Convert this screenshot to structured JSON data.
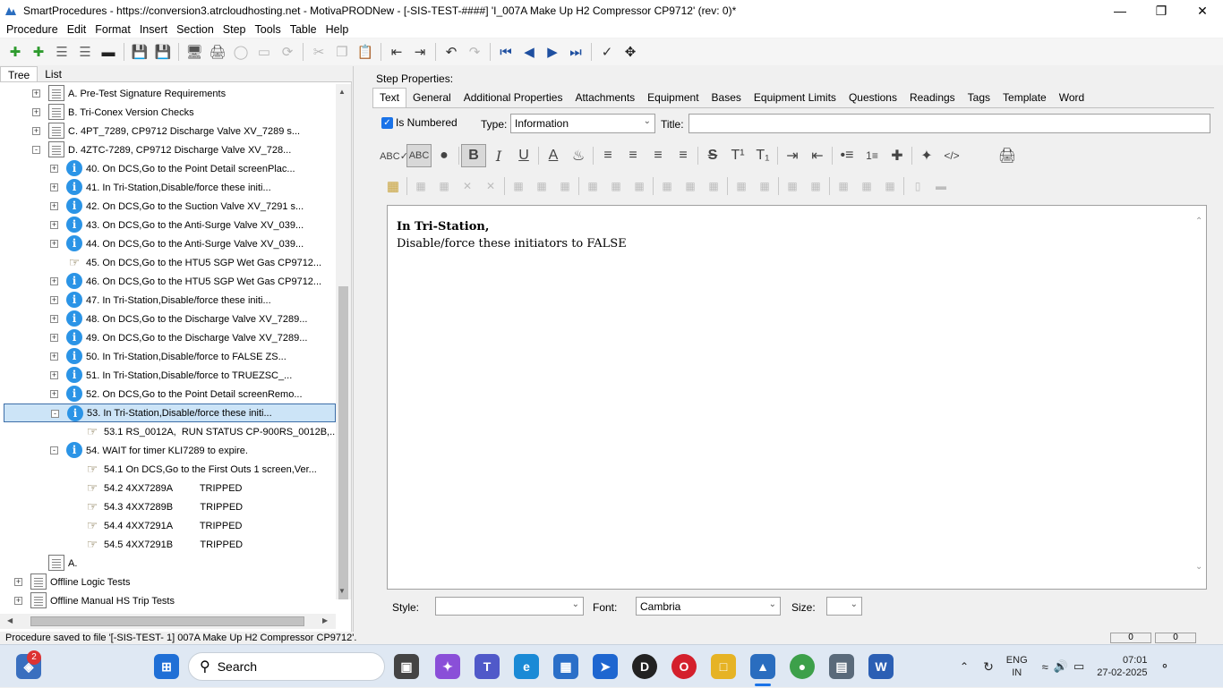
{
  "window": {
    "title": "SmartProcedures - https://conversion3.atrcloudhosting.net - MotivaPRODNew - [-SIS-TEST-####] 'I_007A Make Up H2 Compressor CP9712' (rev: 0)*"
  },
  "menu": [
    "Procedure",
    "Edit",
    "Format",
    "Insert",
    "Section",
    "Step",
    "Tools",
    "Table",
    "Help"
  ],
  "left_tabs": [
    "Tree",
    "List"
  ],
  "tree": [
    {
      "label": "A. Pre-Test Signature Requirements",
      "icon": "doc",
      "level": 1,
      "expander": "+"
    },
    {
      "label": "B. Tri-Conex Version Checks",
      "icon": "doc",
      "level": 1,
      "expander": "+"
    },
    {
      "label": "C. 4PT_7289, CP9712 Discharge Valve XV_7289 s...",
      "icon": "doc",
      "level": 1,
      "expander": "+"
    },
    {
      "label": "D. 4ZTC-7289, CP9712 Discharge Valve XV_728...",
      "icon": "doc",
      "level": 1,
      "expander": "-"
    },
    {
      "label": "40. On DCS,Go to the Point Detail screenPlac...",
      "icon": "info",
      "level": 2,
      "expander": "+"
    },
    {
      "label": "41. In Tri-Station,Disable/force these initi...",
      "icon": "info",
      "level": 2,
      "expander": "+"
    },
    {
      "label": "42. On DCS,Go to the Suction Valve XV_7291 s...",
      "icon": "info",
      "level": 2,
      "expander": "+"
    },
    {
      "label": "43. On DCS,Go to the Anti-Surge Valve XV_039...",
      "icon": "info",
      "level": 2,
      "expander": "+"
    },
    {
      "label": "44. On DCS,Go to the Anti-Surge Valve XV_039...",
      "icon": "info",
      "level": 2,
      "expander": "+"
    },
    {
      "label": "45. On DCS,Go to the HTU5 SGP Wet Gas CP9712...",
      "icon": "hand",
      "level": 2,
      "expander": ""
    },
    {
      "label": "46. On DCS,Go to the HTU5 SGP Wet Gas CP9712...",
      "icon": "info",
      "level": 2,
      "expander": "+"
    },
    {
      "label": "47. In Tri-Station,Disable/force these initi...",
      "icon": "info",
      "level": 2,
      "expander": "+"
    },
    {
      "label": "48. On DCS,Go to the Discharge Valve XV_7289...",
      "icon": "info",
      "level": 2,
      "expander": "+"
    },
    {
      "label": "49. On DCS,Go to the Discharge Valve XV_7289...",
      "icon": "info",
      "level": 2,
      "expander": "+"
    },
    {
      "label": "50. In Tri-Station,Disable/force to FALSE ZS...",
      "icon": "info",
      "level": 2,
      "expander": "+"
    },
    {
      "label": "51. In Tri-Station,Disable/force to TRUEZSC_...",
      "icon": "info",
      "level": 2,
      "expander": "+"
    },
    {
      "label": "52. On DCS,Go to the Point Detail screenRemo...",
      "icon": "info",
      "level": 2,
      "expander": "+"
    },
    {
      "label": "53. In Tri-Station,Disable/force these initi...",
      "icon": "info",
      "level": 2,
      "expander": "-",
      "selected": true
    },
    {
      "label": "53.1 RS_0012A,  RUN STATUS CP-900RS_0012B,...",
      "icon": "hand",
      "level": 3,
      "expander": ""
    },
    {
      "label": "54. WAIT for timer KLI7289 to expire.",
      "icon": "info",
      "level": 2,
      "expander": "-"
    },
    {
      "label": "54.1 On DCS,Go to the First Outs 1 screen,Ver...",
      "icon": "hand",
      "level": 3,
      "expander": ""
    },
    {
      "label": "54.2 4XX7289A          TRIPPED",
      "icon": "hand",
      "level": 3,
      "expander": ""
    },
    {
      "label": "54.3 4XX7289B          TRIPPED",
      "icon": "hand",
      "level": 3,
      "expander": ""
    },
    {
      "label": "54.4 4XX7291A          TRIPPED",
      "icon": "hand",
      "level": 3,
      "expander": ""
    },
    {
      "label": "54.5 4XX7291B          TRIPPED",
      "icon": "hand",
      "level": 3,
      "expander": ""
    },
    {
      "label": "A.",
      "icon": "doc",
      "level": 1,
      "expander": ""
    },
    {
      "label": "Offline Logic Tests",
      "icon": "doc",
      "level": 0,
      "expander": "+"
    },
    {
      "label": "Offline Manual HS Trip Tests",
      "icon": "doc",
      "level": 0,
      "expander": "+"
    }
  ],
  "step_properties": {
    "label": "Step Properties:",
    "tabs": [
      "Text",
      "General",
      "Additional Properties",
      "Attachments",
      "Equipment",
      "Bases",
      "Equipment Limits",
      "Questions",
      "Readings",
      "Tags",
      "Template",
      "Word"
    ],
    "is_numbered_label": "Is Numbered",
    "type_label": "Type:",
    "type_value": "Information",
    "title_label": "Title:",
    "title_value": ""
  },
  "editor": {
    "line1": "In Tri-Station,",
    "line2": "Disable/force these initiators to FALSE"
  },
  "format_bar": {
    "style_label": "Style:",
    "style_value": "",
    "font_label": "Font:",
    "font_value": "Cambria",
    "size_label": "Size:",
    "size_value": ""
  },
  "status": {
    "text": "Procedure saved to file '[-SIS-TEST-     1] 007A Make Up H2 Compressor CP9712'.",
    "pane1": "0",
    "pane2": "0"
  },
  "taskbar": {
    "search_label": "Search",
    "badge": "2",
    "lang": "ENG",
    "region": "IN",
    "time": "07:01",
    "date": "27-02-2025"
  },
  "colors": {
    "accent": "#1a73e8",
    "selection": "#cce4f7",
    "info_icon": "#2b94e6"
  }
}
